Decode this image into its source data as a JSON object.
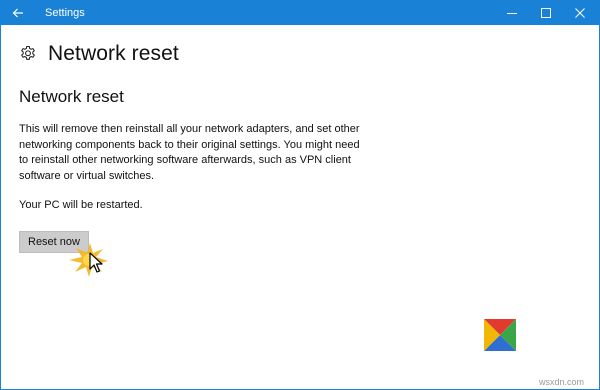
{
  "window": {
    "title": "Settings",
    "accent_color": "#1a82d6"
  },
  "icons": {
    "back": "back-arrow-icon",
    "minimize": "minimize-icon",
    "maximize": "maximize-icon",
    "close": "close-icon",
    "page": "gear-icon"
  },
  "page": {
    "title": "Network reset",
    "section_title": "Network reset",
    "description": "This will remove then reinstall all your network adapters, and set other networking components back to their original settings. You might need to reinstall other networking software afterwards, such as VPN client software or virtual switches.",
    "restart_note": "Your PC will be restarted.",
    "reset_button_label": "Reset now"
  },
  "watermark": {
    "text": "wsxdn.com",
    "logo_colors": [
      "#e23a2e",
      "#3aa648",
      "#2f6fd1",
      "#f2b705"
    ]
  }
}
